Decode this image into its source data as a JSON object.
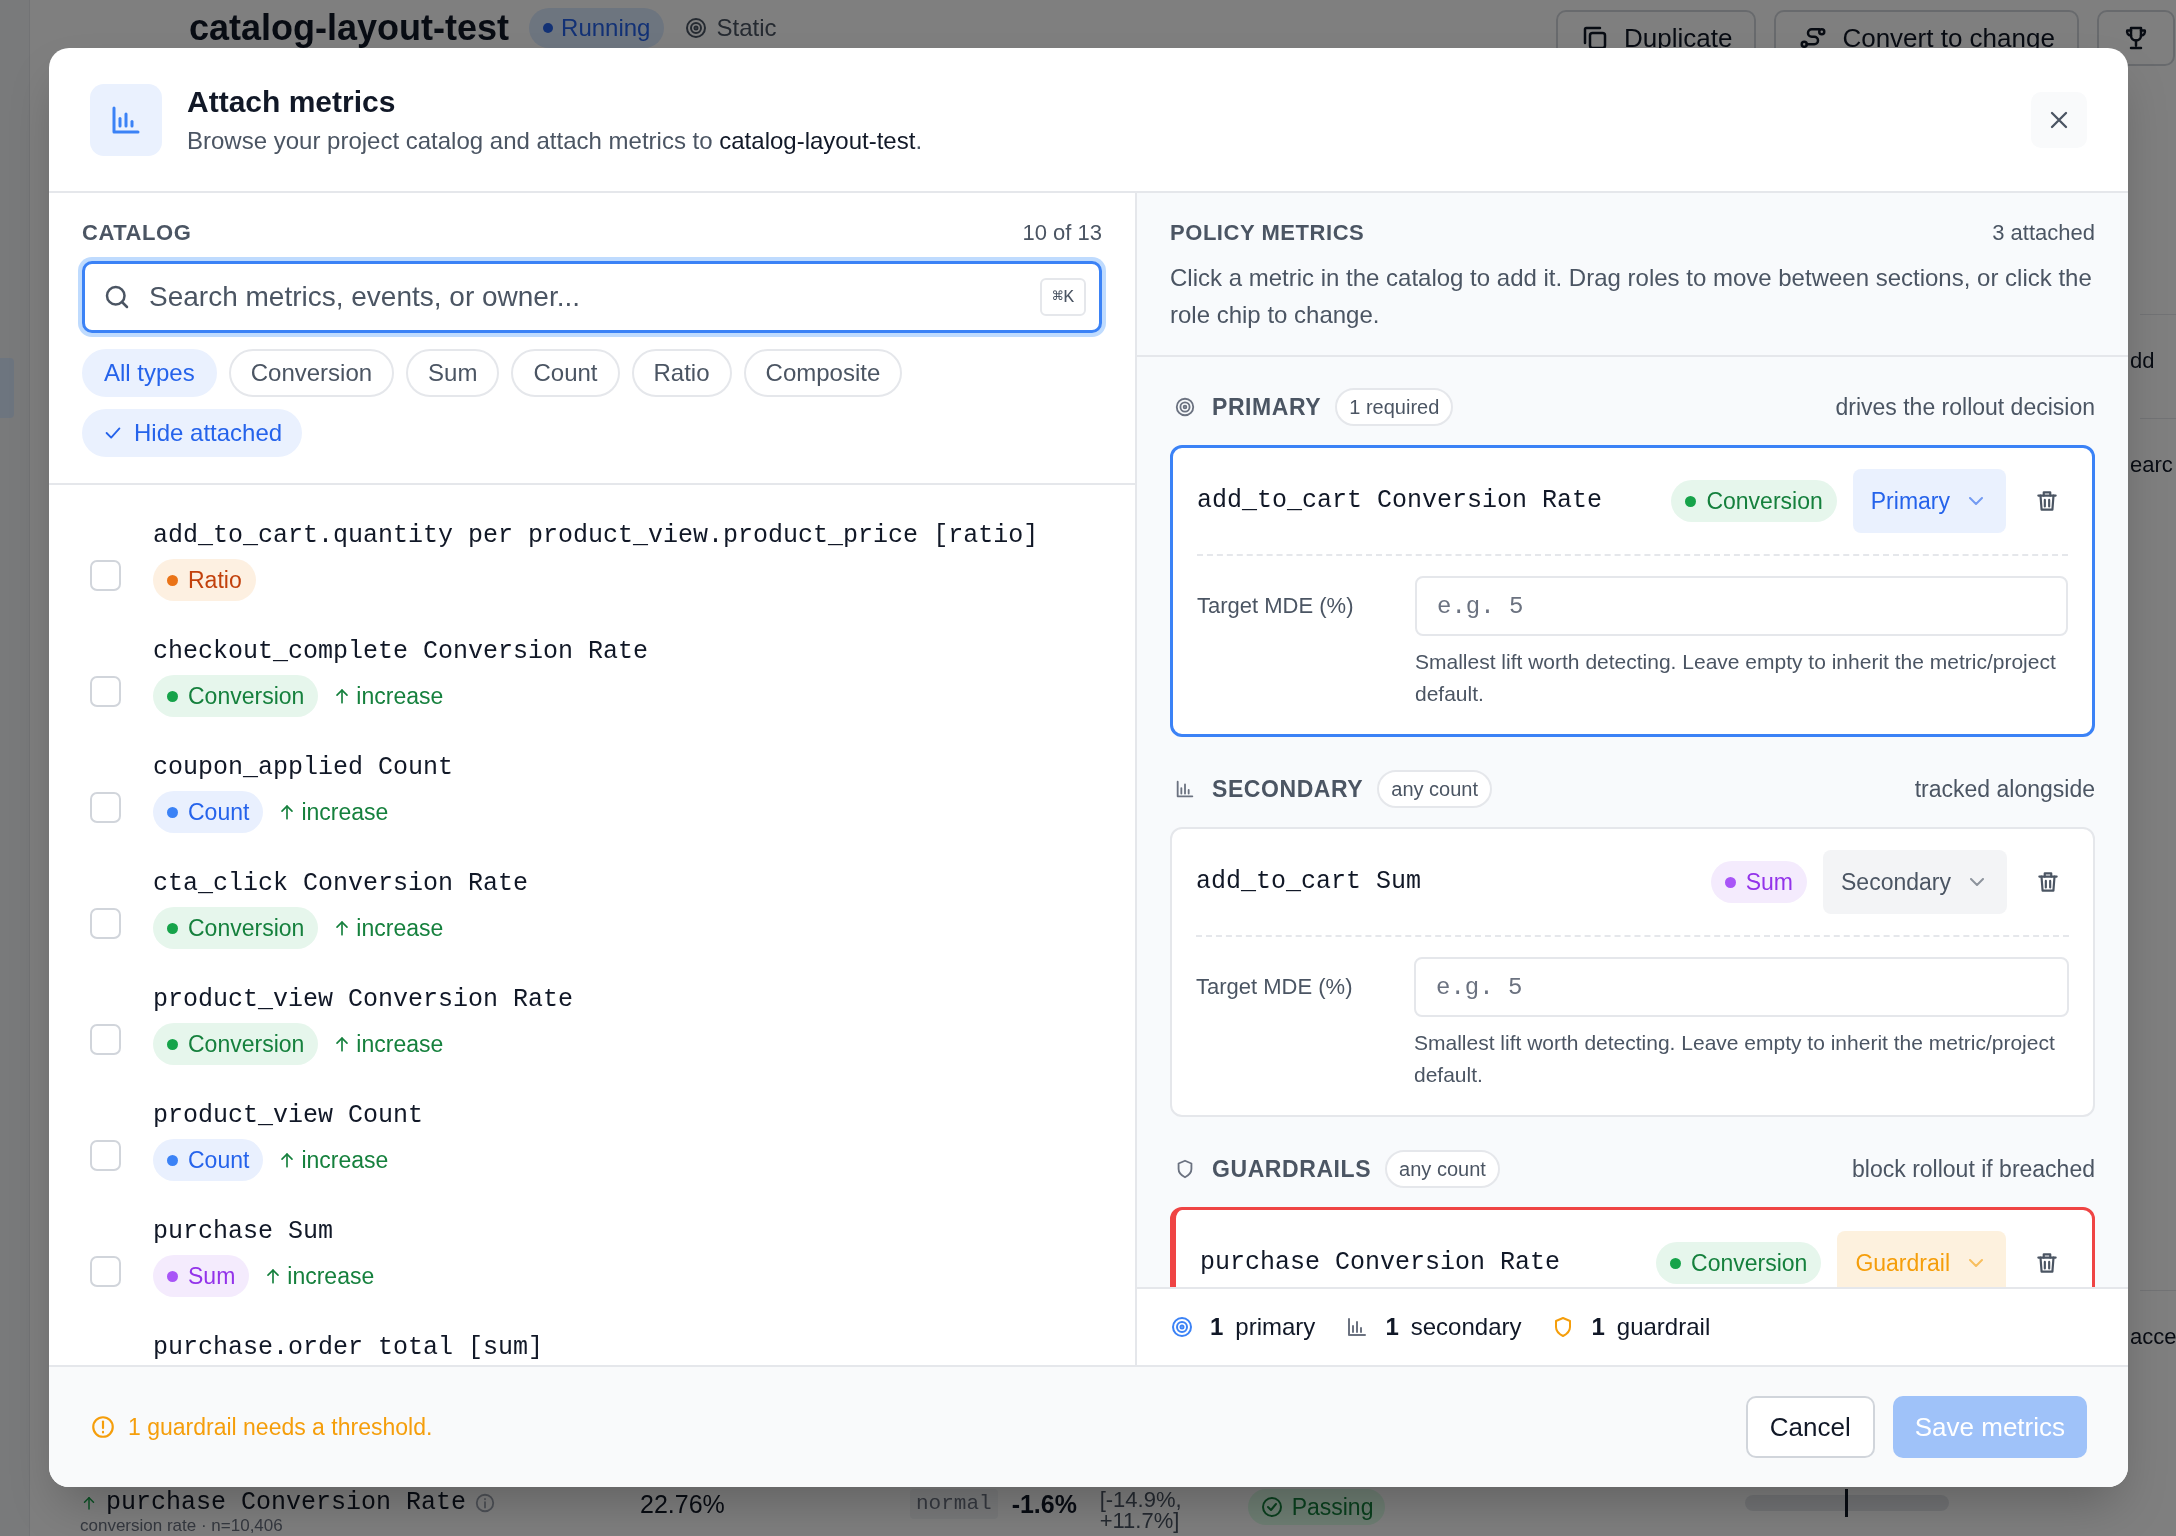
{
  "background_page": {
    "title": "catalog-layout-test",
    "status_badge": "Running",
    "mode": "Static",
    "buttons": [
      {
        "kind": "duplicate",
        "label": "Duplicate"
      },
      {
        "kind": "convert",
        "label": "Convert to change"
      },
      {
        "kind": "trophy"
      }
    ],
    "edge_fragments": [
      "dd",
      "earc",
      "acce"
    ],
    "row": {
      "name": "purchase Conversion Rate",
      "detail": "conversion rate · n=10,406",
      "value": "22.76%",
      "distribution": "normal",
      "lift": "-1.6%",
      "interval": [
        "[-14.9%,",
        "+11.7%]"
      ],
      "status": "Passing"
    }
  },
  "dialog": {
    "title": "Attach metrics",
    "subtitle": "Browse your project catalog and attach metrics to ",
    "subtitle_target": "catalog-layout-test",
    "subtitle_end": "."
  },
  "catalog": {
    "heading": "CATALOG",
    "count": "10 of 13",
    "search": {
      "placeholder": "Search metrics, events, or owner...",
      "shortcut": "⌘K"
    },
    "filters": [
      {
        "label": "All types",
        "selected": true
      },
      {
        "label": "Conversion",
        "selected": false
      },
      {
        "label": "Sum",
        "selected": false
      },
      {
        "label": "Count",
        "selected": false
      },
      {
        "label": "Ratio",
        "selected": false
      },
      {
        "label": "Composite",
        "selected": false
      }
    ],
    "hide_attached": {
      "label": "Hide attached",
      "checked": true
    },
    "metrics": [
      {
        "name": "add_to_cart.quantity per product_view.product_price [ratio]",
        "checked": false,
        "type": {
          "kind": "ratio",
          "label": "Ratio"
        }
      },
      {
        "name": "checkout_complete Conversion Rate",
        "checked": false,
        "type": {
          "kind": "conversion",
          "label": "Conversion"
        },
        "direction": "increase"
      },
      {
        "name": "coupon_applied Count",
        "checked": false,
        "type": {
          "kind": "count",
          "label": "Count"
        },
        "direction": "increase"
      },
      {
        "name": "cta_click Conversion Rate",
        "checked": false,
        "type": {
          "kind": "conversion",
          "label": "Conversion"
        },
        "direction": "increase"
      },
      {
        "name": "product_view Conversion Rate",
        "checked": false,
        "type": {
          "kind": "conversion",
          "label": "Conversion"
        },
        "direction": "increase"
      },
      {
        "name": "product_view Count",
        "checked": false,
        "type": {
          "kind": "count",
          "label": "Count"
        },
        "direction": "increase"
      },
      {
        "name": "purchase Sum",
        "checked": false,
        "type": {
          "kind": "sum",
          "label": "Sum"
        },
        "direction": "increase"
      },
      {
        "name": "purchase.order total [sum]"
      }
    ]
  },
  "policy": {
    "heading": "POLICY METRICS",
    "count": "3 attached",
    "hint": "Click a metric in the catalog to add it. Drag roles to move between sections, or click the role chip to change.",
    "sections": [
      {
        "kind": "primary",
        "title": "PRIMARY",
        "badge": "1 required",
        "note": "drives the rollout decision",
        "metrics": [
          {
            "name": "add_to_cart Conversion Rate",
            "type": {
              "kind": "conversion",
              "label": "Conversion"
            },
            "role": {
              "kind": "primary",
              "label": "Primary"
            },
            "target_label": "Target MDE (%)",
            "placeholder": "e.g. 5",
            "help": "Smallest lift worth detecting. Leave empty to inherit the metric/project default."
          }
        ]
      },
      {
        "kind": "secondary",
        "title": "SECONDARY",
        "badge": "any count",
        "note": "tracked alongside",
        "metrics": [
          {
            "name": "add_to_cart Sum",
            "type": {
              "kind": "sum",
              "label": "Sum"
            },
            "role": {
              "kind": "secondary",
              "label": "Secondary"
            },
            "target_label": "Target MDE (%)",
            "placeholder": "e.g. 5",
            "help": "Smallest lift worth detecting. Leave empty to inherit the metric/project default."
          }
        ]
      },
      {
        "kind": "guardrail",
        "title": "GUARDRAILS",
        "badge": "any count",
        "note": "block rollout if breached",
        "metrics": [
          {
            "name": "purchase Conversion Rate",
            "type": {
              "kind": "conversion",
              "label": "Conversion"
            },
            "role": {
              "kind": "guardrail",
              "label": "Guardrail"
            }
          }
        ]
      }
    ],
    "summary": [
      {
        "kind": "primary",
        "count": "1",
        "label": "primary"
      },
      {
        "kind": "secondary",
        "count": "1",
        "label": "secondary"
      },
      {
        "kind": "guardrail",
        "count": "1",
        "label": "guardrail"
      }
    ]
  },
  "footer": {
    "warning": "1 guardrail needs a threshold.",
    "buttons": [
      {
        "kind": "cancel",
        "label": "Cancel",
        "disabled": false
      },
      {
        "kind": "save",
        "label": "Save metrics",
        "disabled": true
      }
    ]
  }
}
